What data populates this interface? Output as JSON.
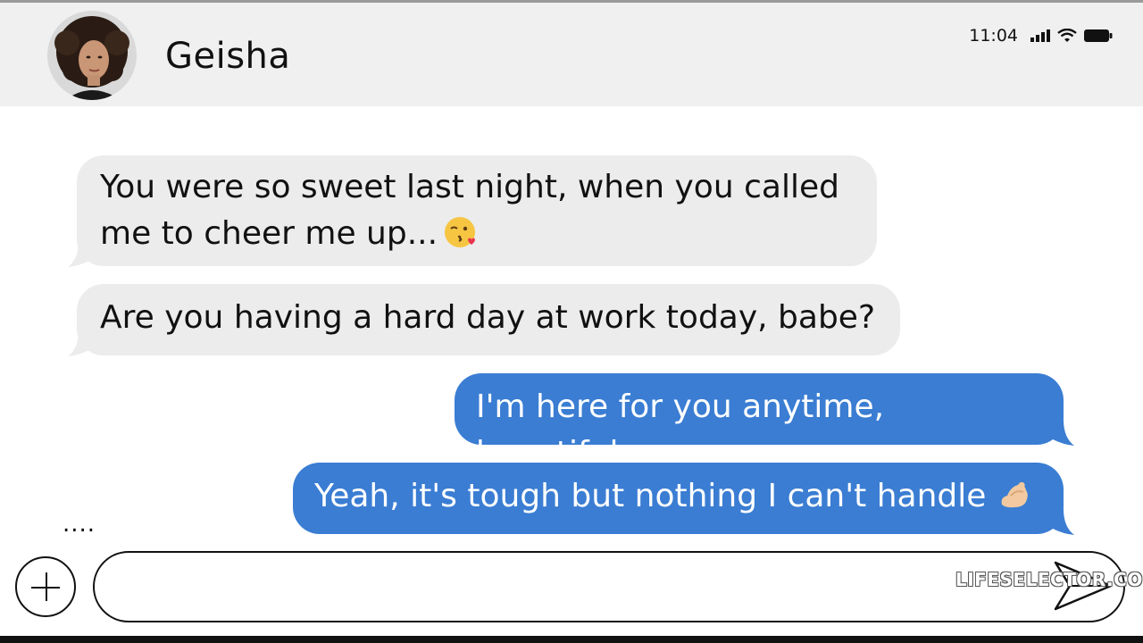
{
  "header": {
    "contact_name": "Geisha",
    "avatar_icon": "contact-avatar-photo"
  },
  "status_bar": {
    "time": "11:04",
    "icons": [
      "signal-icon",
      "wifi-icon",
      "battery-icon"
    ]
  },
  "messages": [
    {
      "direction": "incoming",
      "lines": [
        "You were so sweet last night, when you called",
        "me to cheer me up..."
      ],
      "emoji": "kiss-wink-emoji"
    },
    {
      "direction": "incoming",
      "lines": [
        "Are you having a hard day at work today, babe?"
      ]
    },
    {
      "direction": "outgoing",
      "lines": [
        "I'm here for you anytime, beautiful."
      ]
    },
    {
      "direction": "outgoing",
      "lines": [
        "Yeah, it's tough but nothing I can't handle"
      ],
      "emoji": "flexed-biceps-emoji"
    }
  ],
  "typing_indicator": "....",
  "composer": {
    "add_icon": "plus-icon",
    "send_icon": "send-icon",
    "input_value": ""
  },
  "watermark": "LIFESELECTOR.COM",
  "colors": {
    "header_bg": "#f0f0f0",
    "incoming_bubble": "#ececec",
    "outgoing_bubble": "#3a7dd3"
  }
}
